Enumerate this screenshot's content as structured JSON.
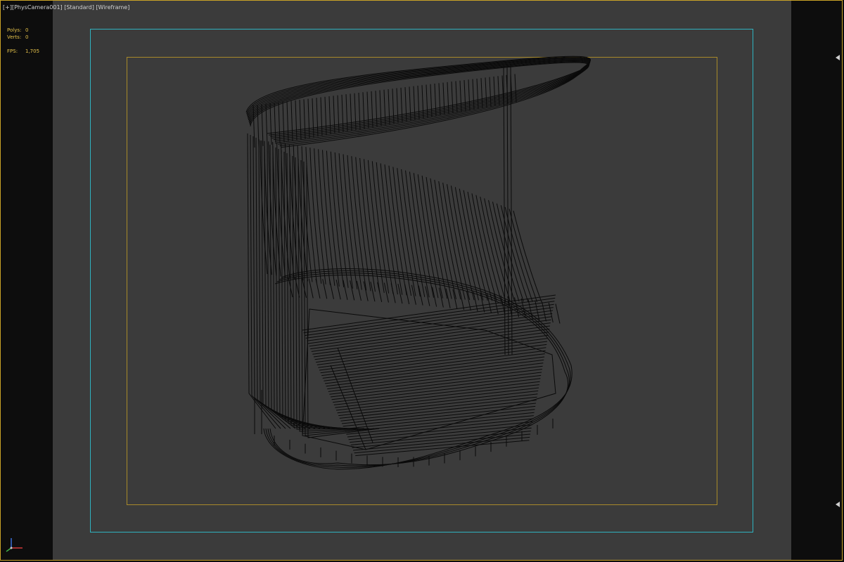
{
  "viewport": {
    "label_plus": "[+]",
    "label_camera": "[PhysCamera001]",
    "label_shading": "[Standard]",
    "label_mode": "[Wireframe]"
  },
  "stats": {
    "polys_label": "Polys:",
    "polys_value": "0",
    "verts_label": "Verts:",
    "verts_value": "0",
    "fps_label": "FPS:",
    "fps_value": "1,705"
  },
  "colors": {
    "frame_border": "#c9a227",
    "safe_frame_outer": "#2fb3c0",
    "safe_frame_inner": "#a88a2a",
    "viewport_bg": "#3b3b3b",
    "stats_text": "#e6c34a",
    "wire": "#0a0a0a"
  },
  "icons": {
    "axis": "axis-tripod-icon",
    "viewport_arrow": "triangle-left-icon"
  }
}
